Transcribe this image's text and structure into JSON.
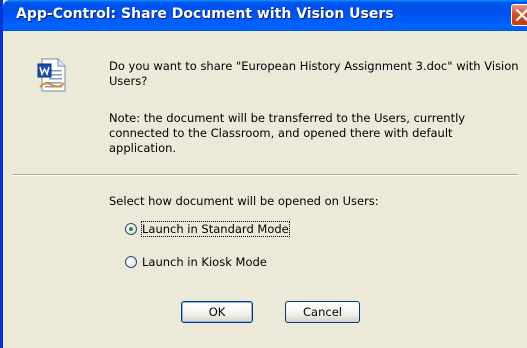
{
  "window": {
    "title": "App-Control: Share Document with Vision Users",
    "close_icon": "close-icon"
  },
  "dialog": {
    "icon": "word-document-icon",
    "question": "Do you want to share \"European History Assignment 3.doc\" with Vision Users?",
    "note": "Note: the document will be transferred to the Users, currently connected to the Classroom, and opened there with default application.",
    "select_label": "Select how document will be opened on Users:",
    "options": [
      {
        "label": "Launch in Standard Mode",
        "selected": true
      },
      {
        "label": "Launch in Kiosk Mode",
        "selected": false
      }
    ],
    "ok_label": "OK",
    "cancel_label": "Cancel"
  },
  "colors": {
    "titlebar": "#0058ee",
    "dialog_bg": "#ece9d8",
    "close_button": "#d14f2c"
  }
}
